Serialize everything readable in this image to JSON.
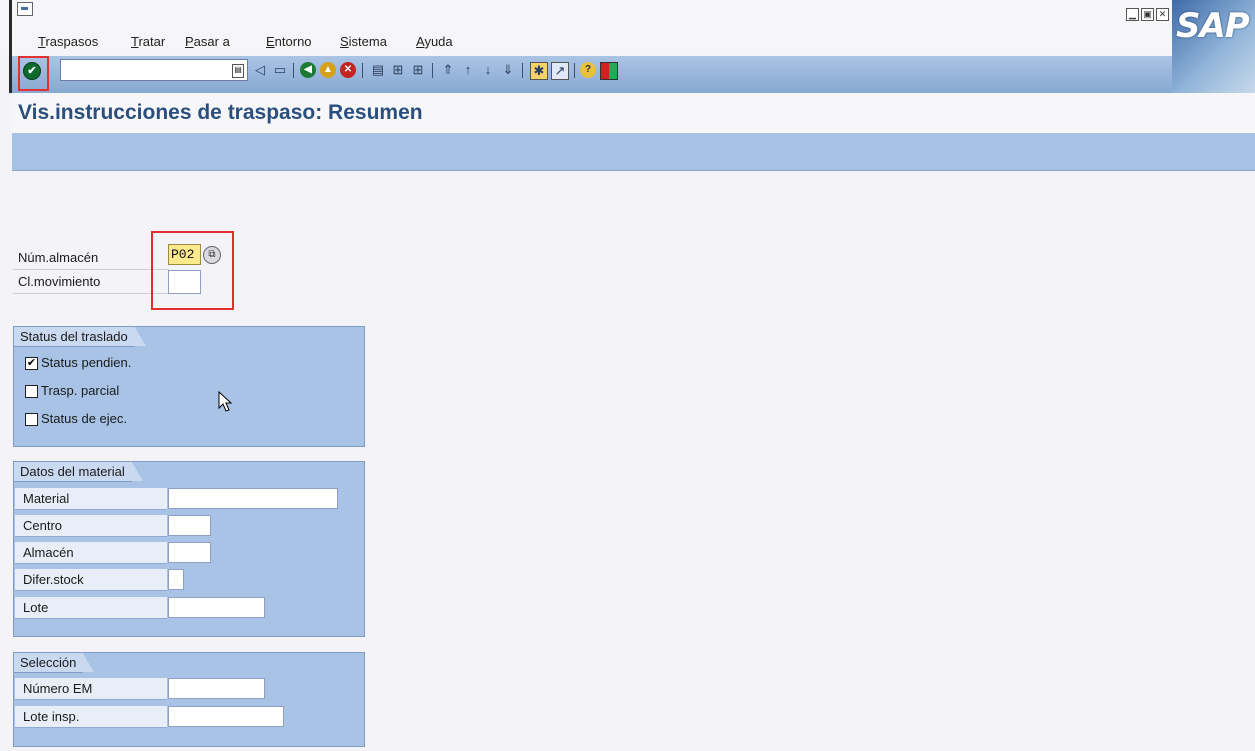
{
  "menubar": {
    "items": [
      {
        "pre": "",
        "ul": "T",
        "post": "raspasos"
      },
      {
        "pre": "",
        "ul": "T",
        "post": "ratar"
      },
      {
        "pre": "",
        "ul": "P",
        "post": "asar a"
      },
      {
        "pre": "",
        "ul": "E",
        "post": "ntorno"
      },
      {
        "pre": "",
        "ul": "S",
        "post": "istema"
      },
      {
        "pre": "",
        "ul": "A",
        "post": "yuda"
      }
    ]
  },
  "logo": {
    "text": "SAP"
  },
  "toolbar": {
    "command_value": "",
    "icons": [
      "enter-icon",
      "back-arrow-icon",
      "save-icon",
      "back-icon",
      "exit-icon",
      "cancel-icon",
      "print-icon",
      "find-icon",
      "find-next-icon",
      "first-page-icon",
      "previous-page-icon",
      "next-page-icon",
      "last-page-icon",
      "create-session-icon",
      "create-shortcut-icon",
      "help-icon",
      "layout-menu-icon"
    ]
  },
  "title": "Vis.instrucciones de traspaso: Resumen",
  "fields": {
    "warehouse_label": "Núm.almacén",
    "warehouse_value": "P02",
    "movement_label": "Cl.movimiento",
    "movement_value": ""
  },
  "status_group": {
    "title": "Status del traslado",
    "checkboxes": [
      {
        "label": "Status pendien.",
        "checked": true
      },
      {
        "label": "Trasp. parcial",
        "checked": false
      },
      {
        "label": "Status de ejec.",
        "checked": false
      }
    ]
  },
  "material_group": {
    "title": "Datos del material",
    "fields": [
      {
        "label": "Material",
        "value": ""
      },
      {
        "label": "Centro",
        "value": ""
      },
      {
        "label": "Almacén",
        "value": ""
      },
      {
        "label": "Difer.stock",
        "value": ""
      },
      {
        "label": "Lote",
        "value": ""
      }
    ]
  },
  "selection_group": {
    "title": "Selección",
    "fields": [
      {
        "label": "Número EM",
        "value": ""
      },
      {
        "label": "Lote insp.",
        "value": ""
      }
    ]
  },
  "colors": {
    "toolbar": "#a7c2e5",
    "title_text": "#2b4f7d",
    "highlight": "#e03030",
    "required_field": "#fbe98c"
  }
}
